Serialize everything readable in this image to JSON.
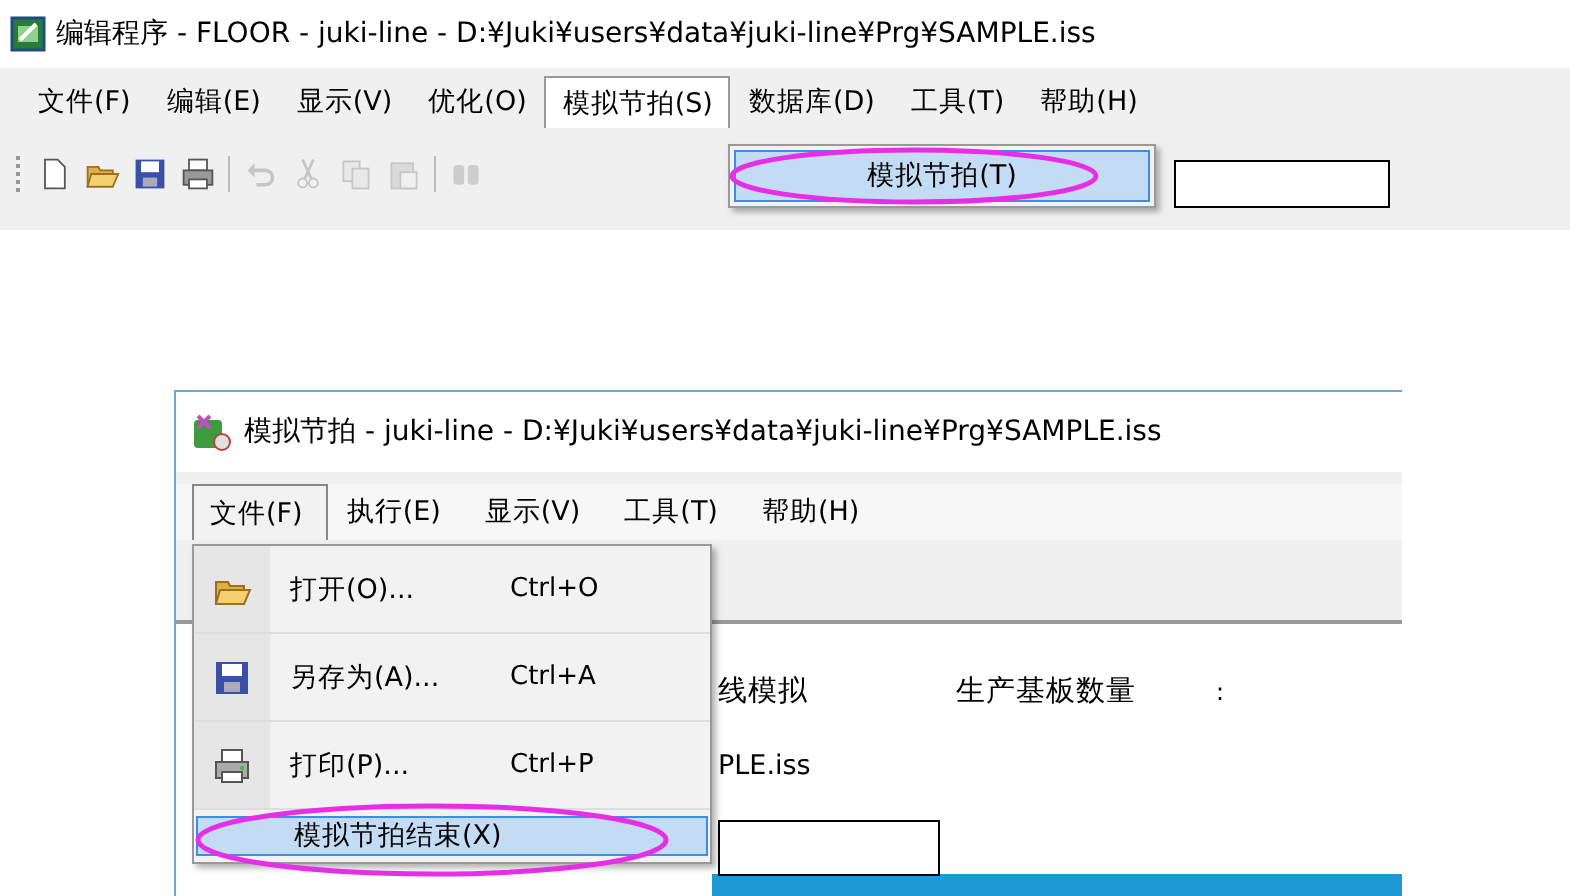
{
  "top_window": {
    "title": "编辑程序 - FLOOR - juki-line - D:¥Juki¥users¥data¥juki-line¥Prg¥SAMPLE.iss",
    "menu": [
      {
        "label": "文件(F)",
        "selected": false
      },
      {
        "label": "编辑(E)",
        "selected": false
      },
      {
        "label": "显示(V)",
        "selected": false
      },
      {
        "label": "优化(O)",
        "selected": false
      },
      {
        "label": "模拟节拍(S)",
        "selected": true
      },
      {
        "label": "数据库(D)",
        "selected": false
      },
      {
        "label": "工具(T)",
        "selected": false
      },
      {
        "label": "帮助(H)",
        "selected": false
      }
    ],
    "toolbar_groups": [
      [
        {
          "kind": "new",
          "disabled": false
        },
        {
          "kind": "open",
          "disabled": false
        },
        {
          "kind": "save",
          "disabled": false
        },
        {
          "kind": "print",
          "disabled": false
        }
      ],
      [
        {
          "kind": "undo",
          "disabled": true
        },
        {
          "kind": "cut",
          "disabled": true
        },
        {
          "kind": "copy",
          "disabled": true
        },
        {
          "kind": "paste",
          "disabled": true
        }
      ],
      [
        {
          "kind": "find",
          "disabled": true
        }
      ]
    ],
    "dropdown": [
      {
        "label": "模拟节拍(T)",
        "selected": true
      }
    ]
  },
  "bottom_window": {
    "title": "模拟节拍 - juki-line - D:¥Juki¥users¥data¥juki-line¥Prg¥SAMPLE.iss",
    "menu": [
      {
        "label": "文件(F)",
        "selected": true
      },
      {
        "label": "执行(E)",
        "selected": false
      },
      {
        "label": "显示(V)",
        "selected": false
      },
      {
        "label": "工具(T)",
        "selected": false
      },
      {
        "label": "帮助(H)",
        "selected": false
      }
    ],
    "dropdown": [
      {
        "kind": "open",
        "label": "打开(O)...",
        "shortcut": "Ctrl+O",
        "selected": false
      },
      {
        "kind": "save",
        "label": "另存为(A)...",
        "shortcut": "Ctrl+A",
        "selected": false
      },
      {
        "kind": "print",
        "label": "打印(P)...",
        "shortcut": "Ctrl+P",
        "selected": false
      },
      {
        "kind": "plain",
        "label": "模拟节拍结束(X)",
        "selected": true
      }
    ],
    "content": {
      "line_label": "线模拟",
      "count_label": "生产基板数量",
      "colon": ":",
      "file_name": "PLE.iss"
    }
  }
}
